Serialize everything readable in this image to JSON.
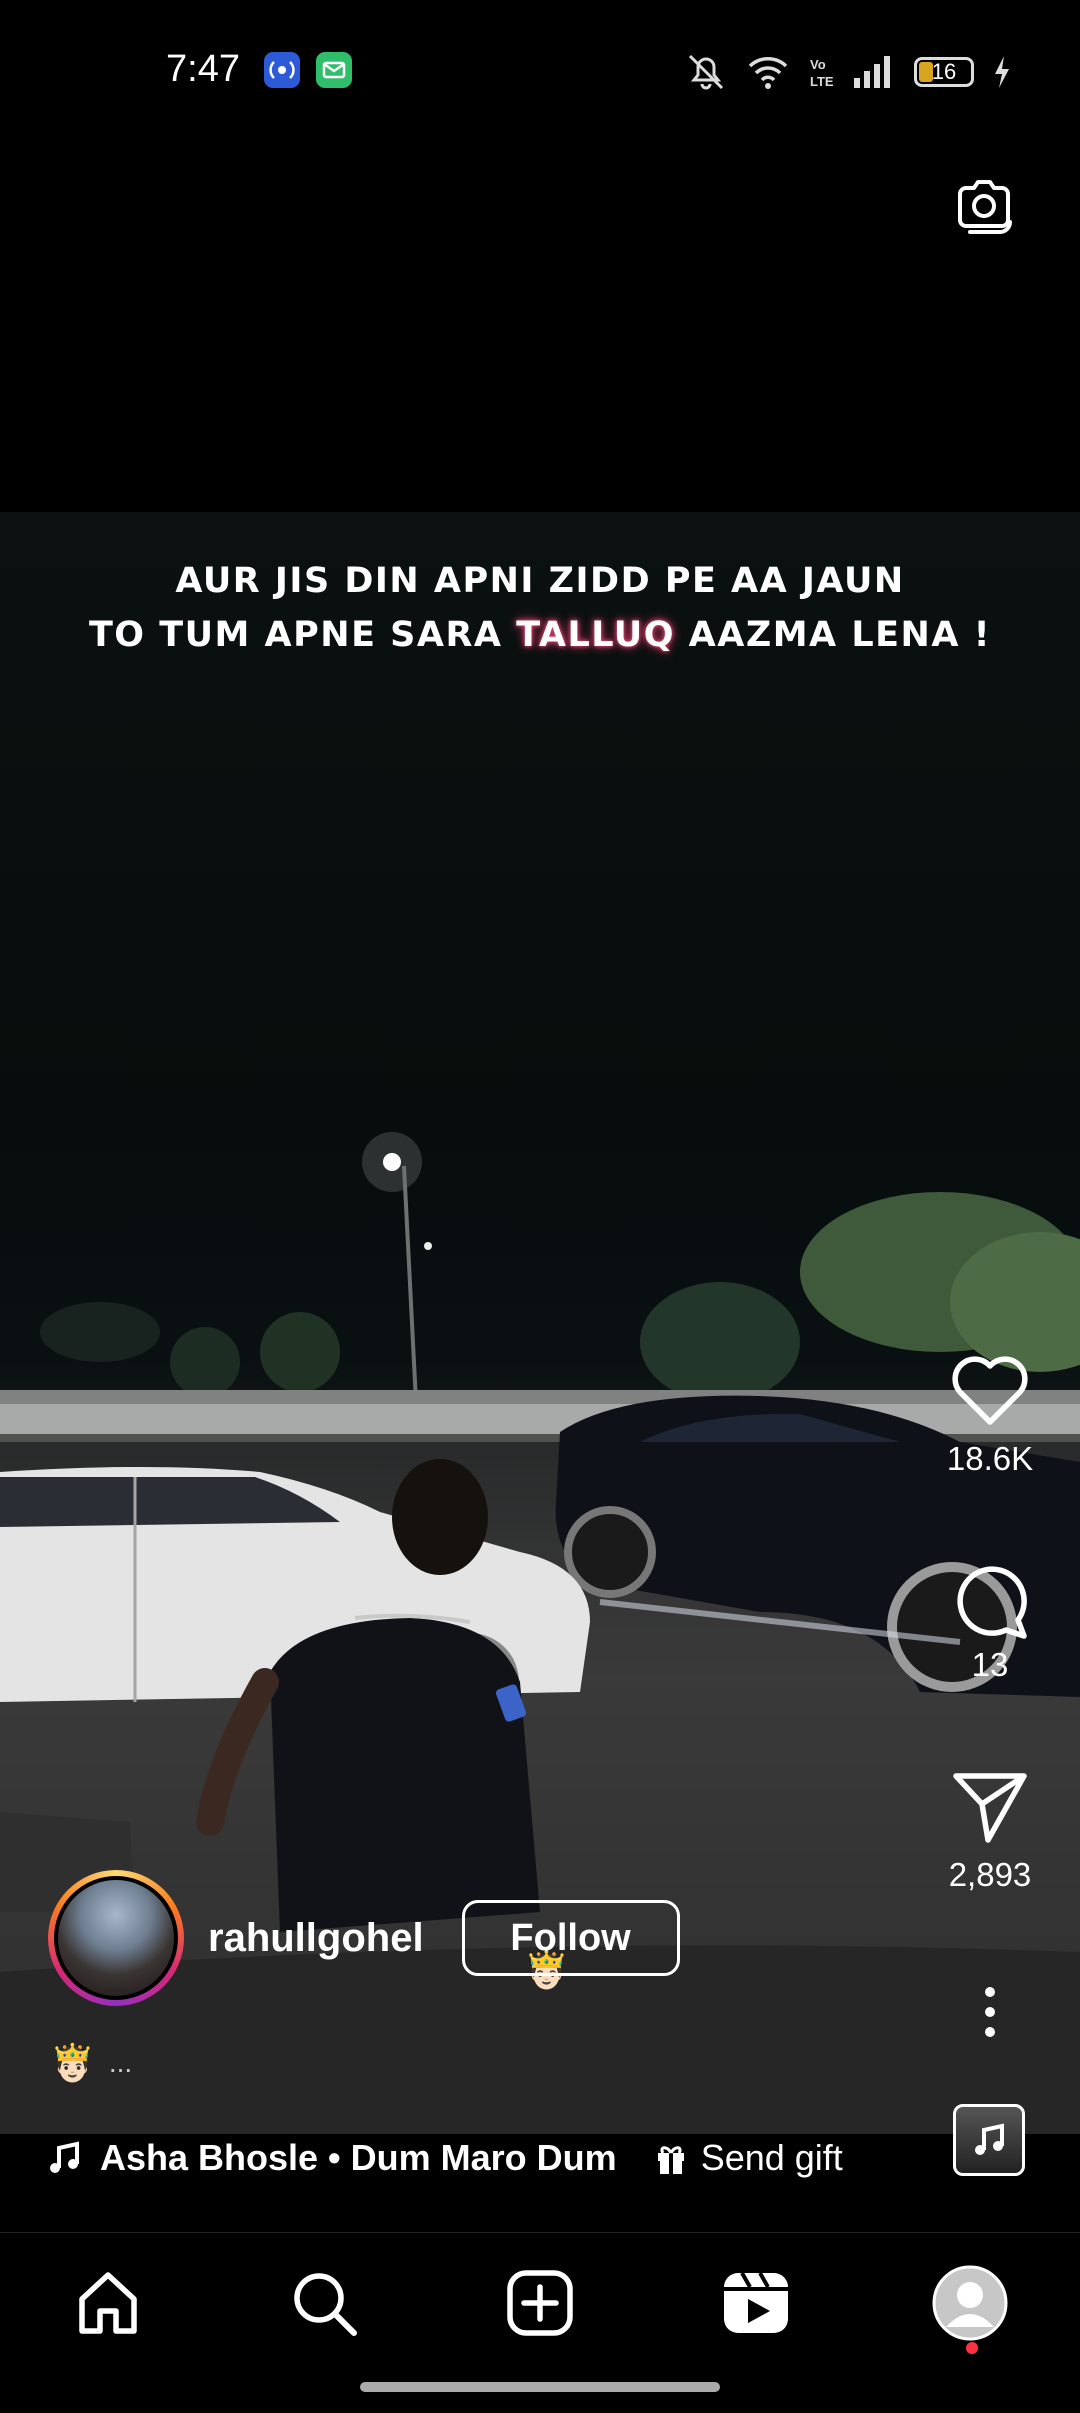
{
  "status_bar": {
    "time": "7:47",
    "battery_level": "16"
  },
  "reel": {
    "caption_line1": "AUR JIS DIN APNI ZIDD PE AA JAUN",
    "caption_line2_pre": "TO TUM APNE SARA ",
    "caption_line2_highlight": "TALLUQ",
    "caption_line2_post": " AAZMA LENA !"
  },
  "actions": {
    "likes": "18.6K",
    "comments": "13",
    "shares": "2,893"
  },
  "author": {
    "username": "rahullgohel",
    "follow_label": "Follow"
  },
  "description": {
    "emoji": "🤴🏻",
    "ellipsis": "..."
  },
  "audio": {
    "track": "Asha Bhosle • Dum Maro Dum",
    "gift_label": "Send gift"
  },
  "nav": {
    "items": [
      "home",
      "search",
      "create",
      "reels",
      "profile"
    ]
  }
}
